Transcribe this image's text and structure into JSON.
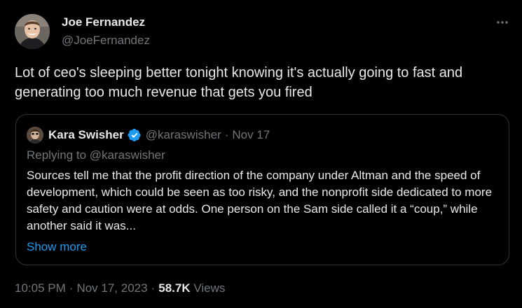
{
  "author": {
    "name": "Joe Fernandez",
    "handle": "@JoeFernandez"
  },
  "tweet": {
    "text": "Lot of ceo's sleeping better tonight knowing it's actually going to fast and generating too much revenue that gets you fired"
  },
  "quoted": {
    "name": "Kara Swisher",
    "verified": true,
    "handle": "@karaswisher",
    "dot": "·",
    "date": "Nov 17",
    "replying_to": "Replying to @karaswisher",
    "text": "Sources tell me that the profit direction of the company under Altman and the speed of development, which could be seen as too risky, and the nonprofit side dedicated to more safety and caution were at odds. One person on the Sam side called it a “coup,” while another said it was...",
    "show_more": "Show more"
  },
  "meta": {
    "time": "10:05 PM",
    "sep1": "·",
    "date": "Nov 17, 2023",
    "sep2": "·",
    "views_count": "58.7K",
    "views_label": "Views"
  },
  "icons": {
    "more": "more-horizontal-icon",
    "verified": "verified-badge-icon"
  },
  "colors": {
    "background": "#000000",
    "text": "#e7e9ea",
    "secondary": "#71767b",
    "link": "#1d9bf0",
    "border": "#2f3336",
    "verified": "#1d9bf0"
  }
}
